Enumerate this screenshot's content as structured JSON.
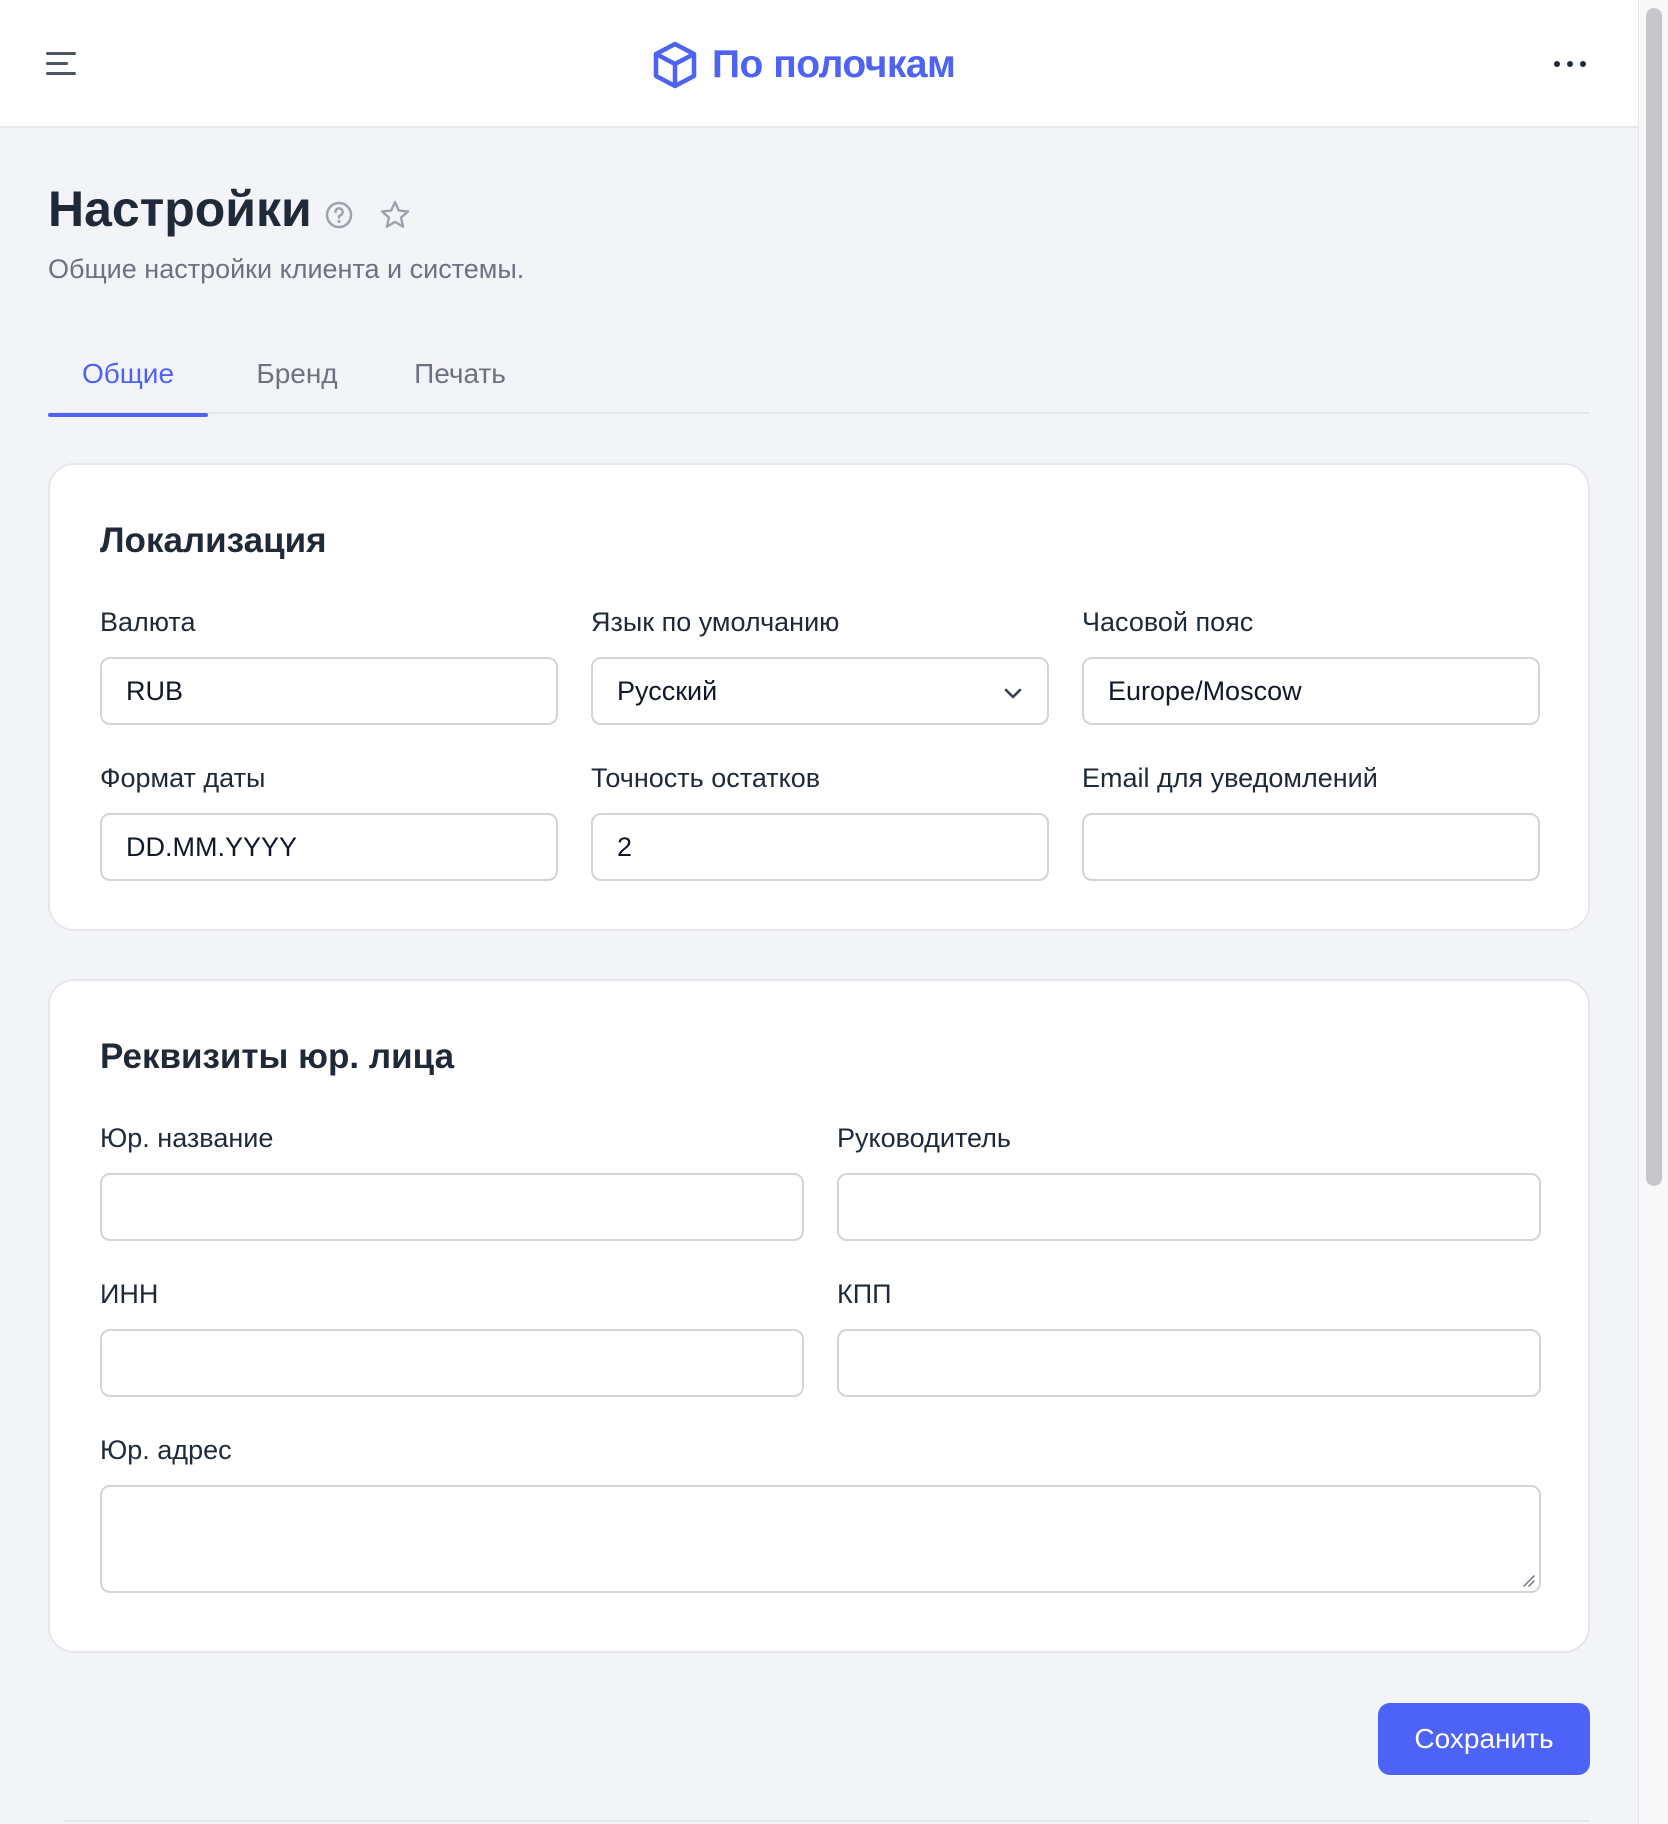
{
  "brand": {
    "name": "По полочкам",
    "logo_icon": "box-3d-icon",
    "accent": "#4f63f2"
  },
  "header": {
    "menu_icon": "hamburger-menu-icon",
    "more_icon": "more-horizontal-icon"
  },
  "page": {
    "title": "Настройки",
    "subtitle": "Общие настройки клиента и системы.",
    "help_icon": "help-circle-icon",
    "star_icon": "star-icon"
  },
  "tabs": [
    {
      "label": "Общие",
      "active": true
    },
    {
      "label": "Бренд",
      "active": false
    },
    {
      "label": "Печать",
      "active": false
    }
  ],
  "localization": {
    "title": "Локализация",
    "currency": {
      "label": "Валюта",
      "value": "RUB"
    },
    "language": {
      "label": "Язык по умолчанию",
      "value": "Русский"
    },
    "timezone": {
      "label": "Часовой пояс",
      "value": "Europe/Moscow"
    },
    "date_format": {
      "label": "Формат даты",
      "value": "DD.MM.YYYY"
    },
    "stock_precision": {
      "label": "Точность остатков",
      "value": "2"
    },
    "notify_email": {
      "label": "Email для уведомлений",
      "value": ""
    }
  },
  "legal": {
    "title": "Реквизиты юр. лица",
    "legal_name": {
      "label": "Юр. название",
      "value": ""
    },
    "director": {
      "label": "Руководитель",
      "value": ""
    },
    "inn": {
      "label": "ИНН",
      "value": ""
    },
    "kpp": {
      "label": "КПП",
      "value": ""
    },
    "address": {
      "label": "Юр. адрес",
      "value": ""
    }
  },
  "actions": {
    "save_label": "Сохранить",
    "save_color": "#4d62f6"
  }
}
